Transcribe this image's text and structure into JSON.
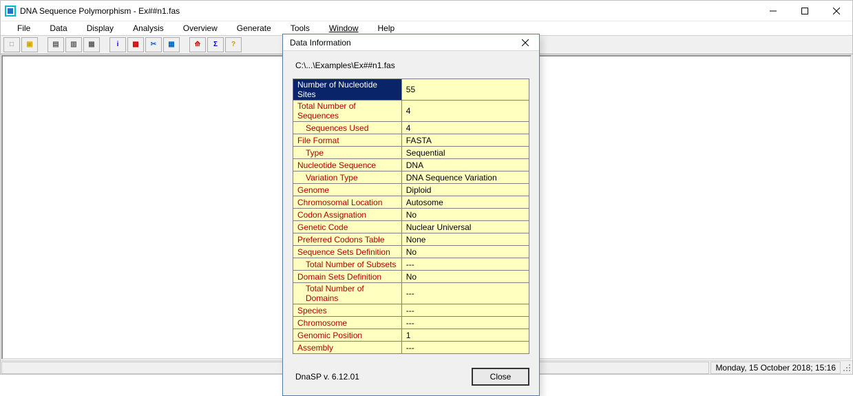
{
  "window": {
    "title": "DNA Sequence Polymorphism - Ex##n1.fas"
  },
  "menu": {
    "items": [
      "File",
      "Data",
      "Display",
      "Analysis",
      "Overview",
      "Generate",
      "Tools",
      "Window",
      "Help"
    ]
  },
  "toolbar": {
    "icons": [
      {
        "name": "new",
        "group": 0,
        "glyph": "□",
        "fg": "#808080"
      },
      {
        "name": "open",
        "group": 0,
        "glyph": "▣",
        "fg": "#d9a400"
      },
      {
        "name": "save",
        "group": 1,
        "glyph": "▤",
        "fg": "#606060"
      },
      {
        "name": "print",
        "group": 1,
        "glyph": "▥",
        "fg": "#606060"
      },
      {
        "name": "printer",
        "group": 1,
        "glyph": "▦",
        "fg": "#606060"
      },
      {
        "name": "info",
        "group": 2,
        "glyph": "i",
        "fg": "#0000ff"
      },
      {
        "name": "options",
        "group": 2,
        "glyph": "▩",
        "fg": "#d00000"
      },
      {
        "name": "cut",
        "group": 2,
        "glyph": "✂",
        "fg": "#0066cc"
      },
      {
        "name": "table",
        "group": 2,
        "glyph": "▦",
        "fg": "#0066cc"
      },
      {
        "name": "chart",
        "group": 3,
        "glyph": "⟰",
        "fg": "#cc0000"
      },
      {
        "name": "sigma",
        "group": 3,
        "glyph": "Σ",
        "fg": "#0000cc"
      },
      {
        "name": "help",
        "group": 3,
        "glyph": "?",
        "fg": "#cc9900"
      }
    ]
  },
  "dialog": {
    "title": "Data Information",
    "path": "C:\\...\\Examples\\Ex##n1.fas",
    "version": "DnaSP v. 6.12.01",
    "close_label": "Close",
    "rows": [
      {
        "k": "Number of Nucleotide Sites",
        "v": "55",
        "indent": false,
        "selected": true
      },
      {
        "k": "Total Number of Sequences",
        "v": "4",
        "indent": false
      },
      {
        "k": "Sequences Used",
        "v": "4",
        "indent": true
      },
      {
        "k": "File Format",
        "v": "FASTA",
        "indent": false
      },
      {
        "k": "Type",
        "v": "Sequential",
        "indent": true
      },
      {
        "k": "Nucleotide Sequence",
        "v": "DNA",
        "indent": false
      },
      {
        "k": "Variation Type",
        "v": "DNA Sequence Variation",
        "indent": true
      },
      {
        "k": "Genome",
        "v": "Diploid",
        "indent": false
      },
      {
        "k": "Chromosomal Location",
        "v": "Autosome",
        "indent": false
      },
      {
        "k": "Codon Assignation",
        "v": "No",
        "indent": false
      },
      {
        "k": "Genetic Code",
        "v": "Nuclear Universal",
        "indent": false
      },
      {
        "k": "Preferred Codons Table",
        "v": "None",
        "indent": false
      },
      {
        "k": "Sequence Sets Definition",
        "v": "No",
        "indent": false
      },
      {
        "k": "Total Number of Subsets",
        "v": "---",
        "indent": true
      },
      {
        "k": "Domain Sets Definition",
        "v": "No",
        "indent": false
      },
      {
        "k": "Total Number of Domains",
        "v": "---",
        "indent": true
      },
      {
        "k": "Species",
        "v": "---",
        "indent": false
      },
      {
        "k": "Chromosome",
        "v": "---",
        "indent": false
      },
      {
        "k": "Genomic Position",
        "v": "1",
        "indent": false
      },
      {
        "k": "Assembly",
        "v": "---",
        "indent": false
      }
    ]
  },
  "status": {
    "datetime": "Monday, 15 October 2018; 15:16"
  }
}
